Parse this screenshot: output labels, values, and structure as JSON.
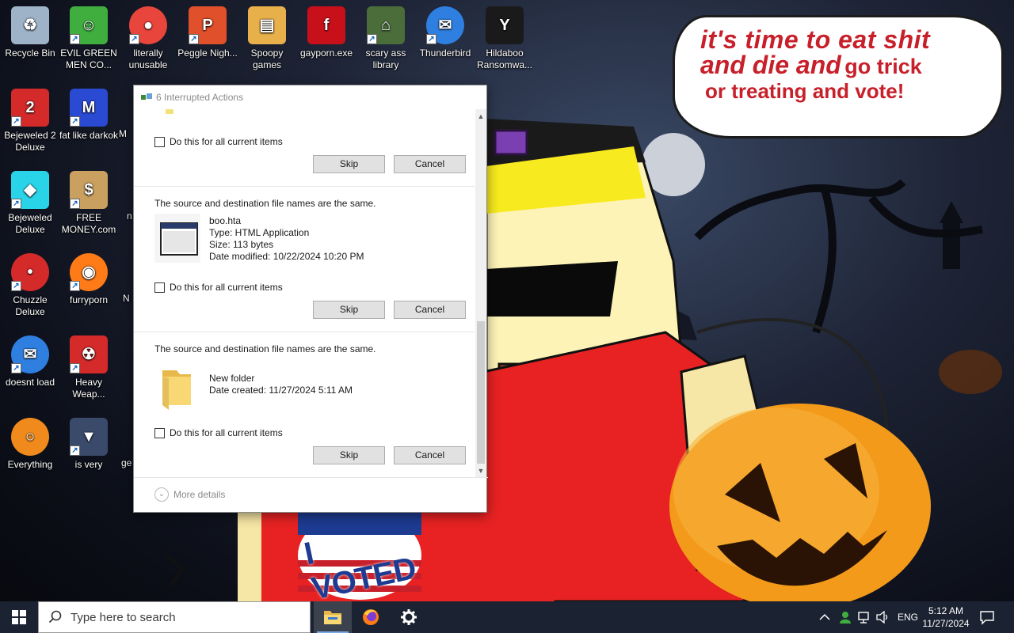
{
  "desktop": {
    "icons": [
      {
        "id": "recycle-bin",
        "label": "Recycle Bin",
        "icon": "recycle-bin-icon",
        "shortcut": false,
        "color": "#9fb3c8"
      },
      {
        "id": "evil-green-men",
        "label": "EVIL GREEN MEN CO...",
        "icon": "people-icon",
        "shortcut": true,
        "color": "#3fae3f"
      },
      {
        "id": "literally-unusable",
        "label": "literally unusable",
        "icon": "chrome-icon",
        "shortcut": true,
        "color": "#e8453c"
      },
      {
        "id": "peggle",
        "label": "Peggle Nigh...",
        "icon": "peggle-icon",
        "shortcut": true,
        "color": "#e0502a"
      },
      {
        "id": "spoopy-games",
        "label": "Spoopy games",
        "icon": "folder-icon",
        "shortcut": false,
        "color": "#e8b04a"
      },
      {
        "id": "gayporn-exe",
        "label": "gayporn.exe",
        "icon": "flash-icon",
        "shortcut": false,
        "color": "#c8101a"
      },
      {
        "id": "scary-ass-library",
        "label": "scary ass library",
        "icon": "library-icon",
        "shortcut": true,
        "color": "#4a6d3a"
      },
      {
        "id": "thunderbird-top",
        "label": "Thunderbird",
        "icon": "thunderbird-icon",
        "shortcut": true,
        "color": "#2f7fe0"
      },
      {
        "id": "hildaboo",
        "label": "Hildaboo Ransomwa...",
        "icon": "yashma-icon",
        "shortcut": false,
        "color": "#1a1a1a"
      },
      {
        "id": "bejeweled-2",
        "label": "Bejeweled 2 Deluxe",
        "icon": "bejeweled2-icon",
        "shortcut": true,
        "color": "#d42a2a"
      },
      {
        "id": "fat-like-darkok",
        "label": "fat like darkok",
        "icon": "mpl-icon",
        "shortcut": true,
        "color": "#2a4ad4"
      },
      {
        "id": "bejeweled",
        "label": "Bejeweled Deluxe",
        "icon": "diamond-icon",
        "shortcut": true,
        "color": "#2ad4e8"
      },
      {
        "id": "free-money",
        "label": "FREE MONEY.com",
        "icon": "money-bag-icon",
        "shortcut": true,
        "color": "#c9a060"
      },
      {
        "id": "chuzzle",
        "label": "Chuzzle Deluxe",
        "icon": "chuzzle-icon",
        "shortcut": true,
        "color": "#d42a2a"
      },
      {
        "id": "furryporn",
        "label": "furryporn",
        "icon": "firefox-icon",
        "shortcut": true,
        "color": "#ff7b18"
      },
      {
        "id": "doesnt-load",
        "label": "doesnt load",
        "icon": "thunderbird-icon",
        "shortcut": true,
        "color": "#2f7fe0"
      },
      {
        "id": "heavy-weapons",
        "label": "Heavy Weap...",
        "icon": "radiation-icon",
        "shortcut": true,
        "color": "#d42a2a"
      },
      {
        "id": "everything",
        "label": "Everything",
        "icon": "search-ring-icon",
        "shortcut": false,
        "color": "#f08a1c"
      },
      {
        "id": "is-very",
        "label": "is very",
        "icon": "mpl-shield-icon",
        "shortcut": true,
        "color": "#3a4a6a"
      }
    ],
    "partial_labels": [
      "M",
      "n",
      "N",
      "ge"
    ]
  },
  "speech_bubble": {
    "line1": "it's time to eat shit",
    "line2a": "and die and",
    "line2b": "go trick",
    "line3": "or treating and vote!"
  },
  "badge": {
    "text": "I VOTED"
  },
  "dialog": {
    "title": "6 Interrupted Actions",
    "sections": [
      {
        "message": "",
        "file": null,
        "checkbox_label": "Do this for all current items",
        "skip_label": "Skip",
        "cancel_label": "Cancel"
      },
      {
        "message": "The source and destination file names are the same.",
        "file": {
          "name": "boo.hta",
          "type": "Type: HTML Application",
          "size": "Size: 113 bytes",
          "date": "Date modified: 10/22/2024 10:20 PM",
          "icon": "hta-window-icon"
        },
        "checkbox_label": "Do this for all current items",
        "skip_label": "Skip",
        "cancel_label": "Cancel"
      },
      {
        "message": "The source and destination file names are the same.",
        "file": {
          "name": "New folder",
          "type": "",
          "size": "",
          "date": "Date created: 11/27/2024 5:11 AM",
          "icon": "folder-icon"
        },
        "checkbox_label": "Do this for all current items",
        "skip_label": "Skip",
        "cancel_label": "Cancel"
      }
    ],
    "more_details": "More details"
  },
  "taskbar": {
    "search_placeholder": "Type here to search",
    "apps": [
      {
        "name": "file-explorer-icon",
        "running": true,
        "active": true
      },
      {
        "name": "firefox-icon",
        "running": false,
        "active": false
      },
      {
        "name": "settings-gear-icon",
        "running": false,
        "active": false
      }
    ],
    "tray": {
      "language": "ENG",
      "time": "5:12 AM",
      "date": "11/27/2024"
    }
  },
  "colors": {
    "taskbar_bg": "#1b2332",
    "bubble_text": "#c8202a",
    "dialog_bg": "#ffffff"
  }
}
